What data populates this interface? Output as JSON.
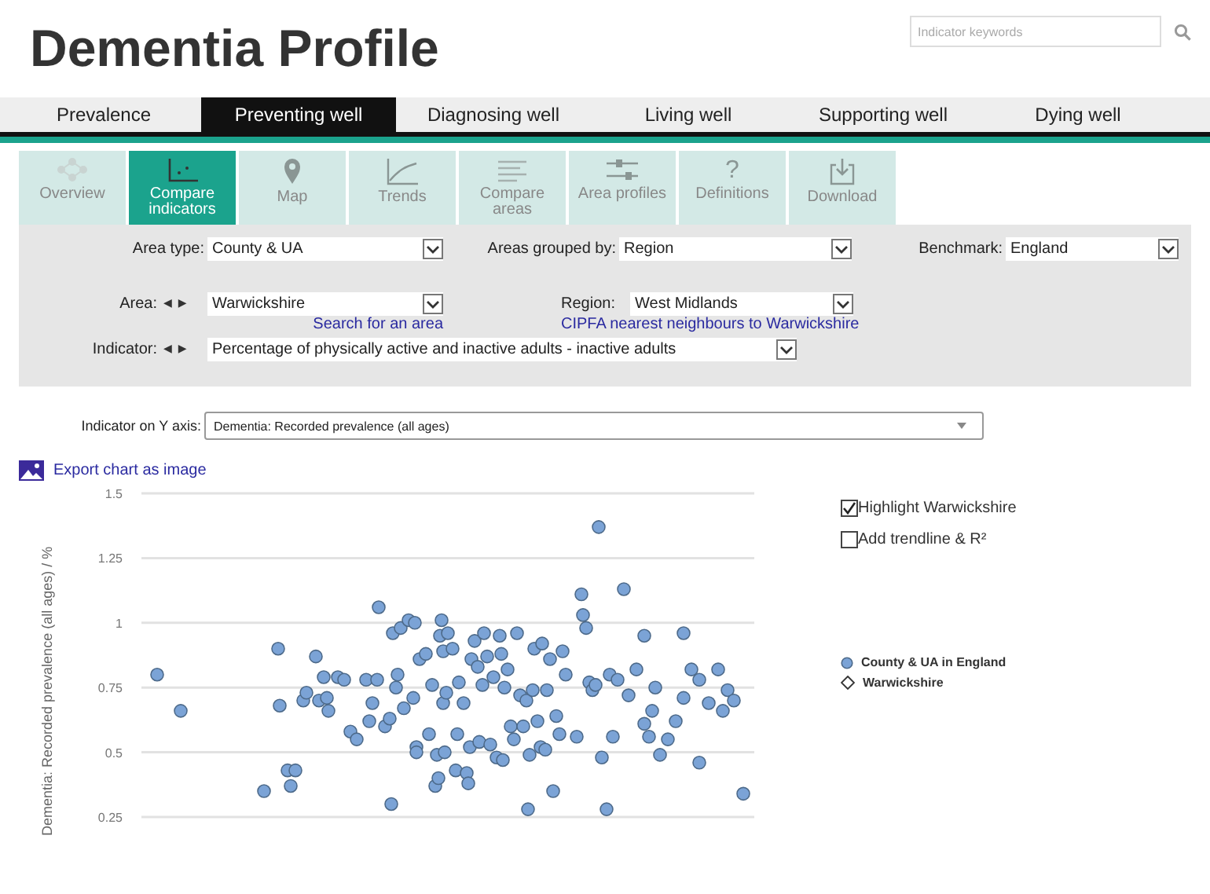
{
  "header": {
    "title": "Dementia Profile",
    "search": {
      "placeholder": "Indicator keywords"
    }
  },
  "domain_tabs": [
    {
      "label": "Prevalence",
      "selected": false
    },
    {
      "label": "Preventing well",
      "selected": true
    },
    {
      "label": "Diagnosing well",
      "selected": false
    },
    {
      "label": "Living well",
      "selected": false
    },
    {
      "label": "Supporting well",
      "selected": false
    },
    {
      "label": "Dying well",
      "selected": false
    }
  ],
  "view_tabs": [
    {
      "label": "Overview",
      "selected": false
    },
    {
      "label": "Compare indicators",
      "selected": true
    },
    {
      "label": "Map",
      "selected": false
    },
    {
      "label": "Trends",
      "selected": false
    },
    {
      "label": "Compare areas",
      "selected": false
    },
    {
      "label": "Area profiles",
      "selected": false
    },
    {
      "label": "Definitions",
      "glyph": "?",
      "selected": false
    },
    {
      "label": "Download",
      "selected": false
    }
  ],
  "filters": {
    "area_type": {
      "label": "Area type:",
      "value": "County & UA"
    },
    "grouped_by": {
      "label": "Areas grouped by:",
      "value": "Region"
    },
    "benchmark": {
      "label": "Benchmark:",
      "value": "England"
    },
    "area": {
      "label": "Area:",
      "prev": "◀",
      "next": "▶",
      "value": "Warwickshire",
      "link": "Search for an area"
    },
    "region": {
      "label": "Region:",
      "value": "West Midlands",
      "link": "CIPFA nearest neighbours to Warwickshire"
    },
    "indicator": {
      "label": "Indicator:",
      "prev": "◀",
      "next": "▶",
      "value": "Percentage of physically active and inactive adults - inactive adults"
    }
  },
  "y_axis_selector": {
    "label": "Indicator on Y axis:",
    "value": "Dementia: Recorded prevalence (all ages)"
  },
  "export_link": "Export chart as image",
  "options": [
    {
      "label": "Highlight Warwickshire",
      "checked": true
    },
    {
      "label": "Add trendline & R²",
      "checked": false
    }
  ],
  "chart": {
    "y_title": "Dementia: Recorded prevalence (all ages) / %",
    "y_ticks": [
      "1.5",
      "1.25",
      "1",
      "0.75",
      "0.5",
      "0.25"
    ],
    "legend": [
      {
        "label": "County & UA in England",
        "kind": "dot"
      },
      {
        "label": "Warwickshire",
        "kind": "diamond"
      }
    ]
  }
}
